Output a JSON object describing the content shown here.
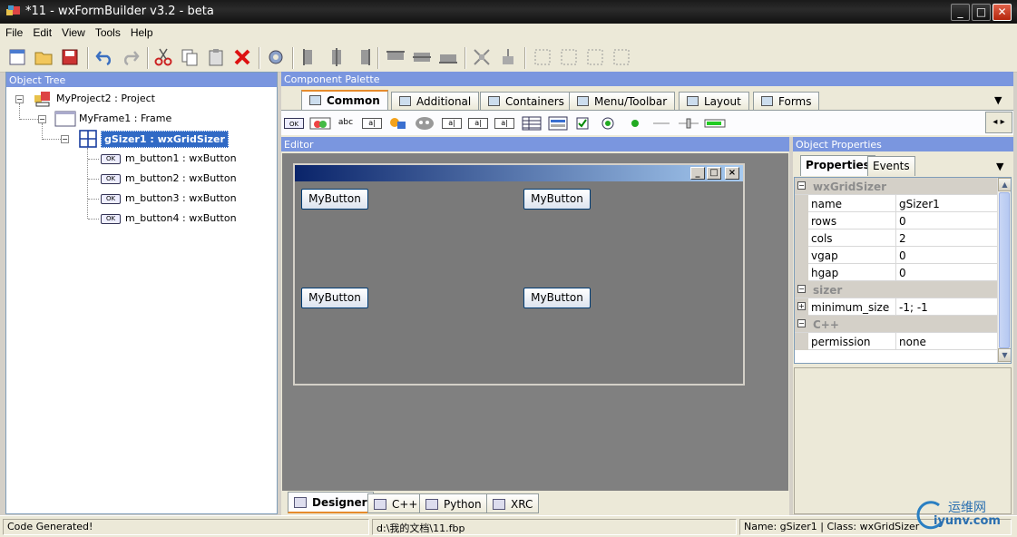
{
  "window": {
    "title": "*11 - wxFormBuilder v3.2 - beta"
  },
  "menu": [
    "File",
    "Edit",
    "View",
    "Tools",
    "Help"
  ],
  "object_tree": {
    "header": "Object Tree",
    "project": "MyProject2 : Project",
    "frame": "MyFrame1 : Frame",
    "sizer": "gSizer1 : wxGridSizer",
    "buttons": [
      "m_button1 : wxButton",
      "m_button2 : wxButton",
      "m_button3 : wxButton",
      "m_button4 : wxButton"
    ]
  },
  "palette": {
    "header": "Component Palette",
    "tabs": [
      "Common",
      "Additional",
      "Containers",
      "Menu/Toolbar",
      "Layout",
      "Forms"
    ],
    "active_tab": "Common",
    "item_labels": [
      "OK",
      "abc",
      "a|",
      "a|",
      "a|",
      "a|",
      "a|"
    ]
  },
  "editor": {
    "header": "Editor",
    "buttons": [
      "MyButton",
      "MyButton",
      "MyButton",
      "MyButton"
    ],
    "tabs": [
      "Designer",
      "C++",
      "Python",
      "XRC"
    ],
    "active_tab": "Designer"
  },
  "properties": {
    "header": "Object Properties",
    "tabs": [
      "Properties",
      "Events"
    ],
    "rows": [
      {
        "cat": "wxGridSizer"
      },
      {
        "k": "name",
        "v": "gSizer1"
      },
      {
        "k": "rows",
        "v": "0"
      },
      {
        "k": "cols",
        "v": "2"
      },
      {
        "k": "vgap",
        "v": "0"
      },
      {
        "k": "hgap",
        "v": "0"
      },
      {
        "cat": "sizer"
      },
      {
        "k": "minimum_size",
        "v": "-1; -1",
        "expand": true
      },
      {
        "cat": "C++"
      },
      {
        "k": "permission",
        "v": "none"
      }
    ]
  },
  "status": {
    "left": "Code Generated!",
    "path": "d:\\我的文档\\11.fbp",
    "info": "Name: gSizer1 | Class: wxGridSizer"
  },
  "watermark": {
    "cn": "运维网",
    "url": "iyunv.com"
  },
  "colors": {
    "panel_header": "#7a96df",
    "selection": "#316ac5",
    "editor_bg": "#808080",
    "tab_accent": "#e68b2c"
  }
}
